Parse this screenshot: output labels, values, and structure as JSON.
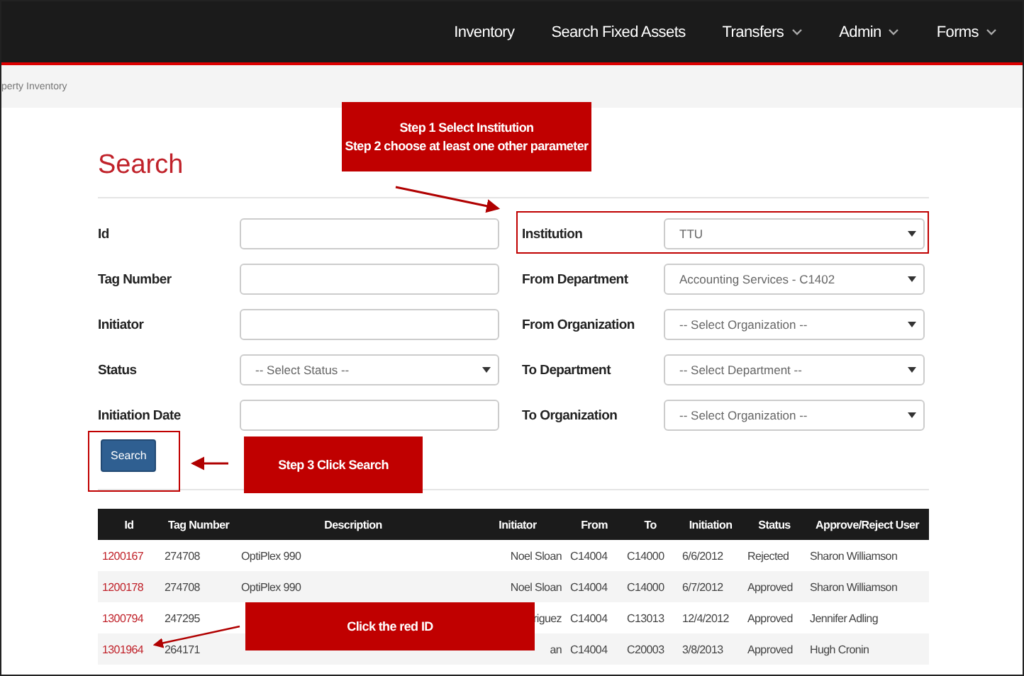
{
  "nav": {
    "items": [
      {
        "label": "Inventory",
        "dropdown": false
      },
      {
        "label": "Search Fixed Assets",
        "dropdown": false
      },
      {
        "label": "Transfers",
        "dropdown": true
      },
      {
        "label": "Admin",
        "dropdown": true
      },
      {
        "label": "Forms",
        "dropdown": true
      }
    ]
  },
  "breadcrumb": "perty Inventory",
  "title": "Search",
  "left_fields": [
    {
      "label": "Id",
      "kind": "text"
    },
    {
      "label": "Tag Number",
      "kind": "text"
    },
    {
      "label": "Initiator",
      "kind": "text"
    },
    {
      "label": "Status",
      "kind": "select",
      "value": "-- Select Status --"
    },
    {
      "label": "Initiation Date",
      "kind": "text"
    }
  ],
  "right_fields": [
    {
      "label": "Institution",
      "kind": "select",
      "value": "TTU"
    },
    {
      "label": "From Department",
      "kind": "select",
      "value": "Accounting Services - C1402"
    },
    {
      "label": "From Organization",
      "kind": "select",
      "value": "-- Select Organization --"
    },
    {
      "label": "To Department",
      "kind": "select",
      "value": "-- Select Department --"
    },
    {
      "label": "To Organization",
      "kind": "select",
      "value": "-- Select Organization --"
    }
  ],
  "search_button": "Search",
  "table": {
    "columns": [
      "Id",
      "Tag Number",
      "Description",
      "Initiator",
      "From",
      "To",
      "Initiation",
      "Status",
      "Approve/Reject User"
    ],
    "rows": [
      [
        "1200167",
        "274708",
        "OptiPlex 990",
        "Noel Sloan",
        "C14004",
        "C14000",
        "6/6/2012",
        "Rejected",
        "Sharon Williamson"
      ],
      [
        "1200178",
        "274708",
        "OptiPlex 990",
        "Noel Sloan",
        "C14004",
        "C14000",
        "6/7/2012",
        "Approved",
        "Sharon Williamson"
      ],
      [
        "1300794",
        "247295",
        null,
        "riguez",
        "C14004",
        "C13013",
        "12/4/2012",
        "Approved",
        "Jennifer Adling"
      ],
      [
        "1301964",
        "264171",
        null,
        "an",
        "C14004",
        "C20003",
        "3/8/2013",
        "Approved",
        "Hugh Cronin"
      ]
    ]
  },
  "callouts": [
    "Step 1 Select Institution\nStep 2 choose at least one other parameter",
    "Step 3 Click Search",
    "Click the red ID"
  ]
}
